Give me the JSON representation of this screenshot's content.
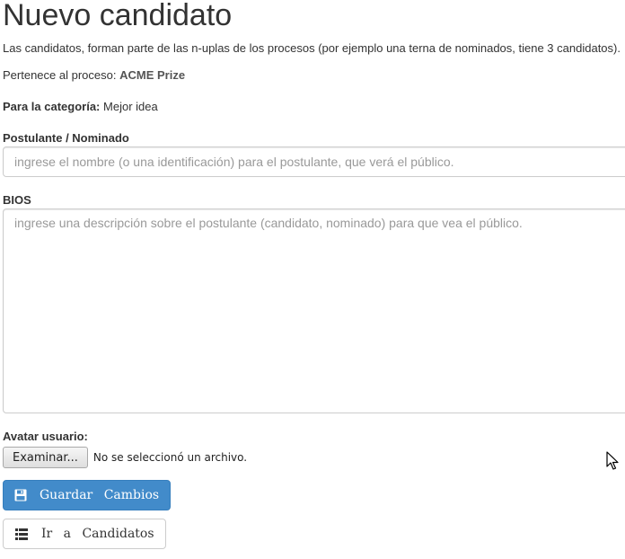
{
  "page": {
    "title": "Nuevo candidato",
    "description": "Las candidatos, forman parte de las n-uplas de los procesos (por ejemplo una terna de nominados, tiene 3 candidatos).",
    "process_prefix": "Pertenece al proceso:",
    "process_name": "ACME Prize",
    "category_label": "Para la categoría:",
    "category_value": "Mejor idea"
  },
  "form": {
    "name_label": "Postulante / Nominado",
    "name_value": "",
    "name_placeholder": "ingrese el nombre (o una identificación) para el postulante, que verá el público.",
    "bios_label": "BIOS",
    "bios_value": "",
    "bios_placeholder": "ingrese una descripción sobre el postulante (candidato, nominado) para que vea el público.",
    "avatar_label": "Avatar usuario:",
    "file_button_label": "Examinar...",
    "file_status": "No se seleccionó un archivo."
  },
  "actions": {
    "save_label": "Guardar Cambios",
    "save_icon": "floppy-disk-icon",
    "candidates_label": "Ir a Candidatos",
    "candidates_icon": "list-icon"
  },
  "colors": {
    "primary": "#428bca",
    "text": "#333333",
    "placeholder": "#999999",
    "border": "#cccccc"
  }
}
